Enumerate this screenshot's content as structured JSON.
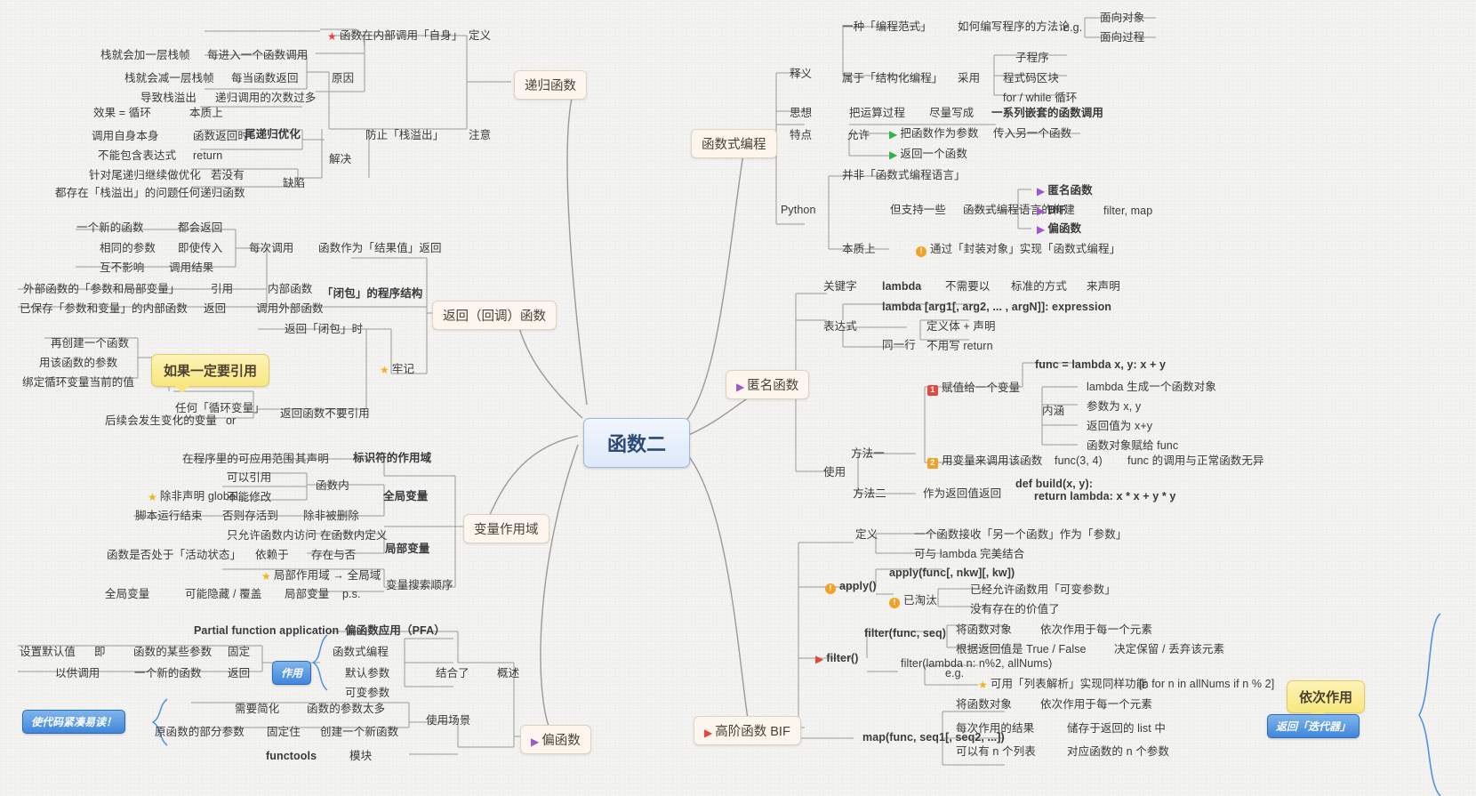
{
  "title": "函数二",
  "colors": {
    "background": "#f3f2f0",
    "center_fill": "#dde9fa",
    "center_border": "#9cb8da",
    "topic_fill": "#fdf6ee",
    "bubble_fill": "#f8e77e",
    "pill_fill": "#3f86dc",
    "star_red": "#e8453c",
    "star_yellow": "#f2b41c",
    "flag_green": "#33b24b",
    "flag_purple": "#9b59d0",
    "flag_red": "#e8453c",
    "warn_orange": "#f0a126"
  },
  "topics": {
    "recursive": "递归函数",
    "functional": "函数式编程",
    "callback": "返回（回调）函数",
    "anonymous": "匿名函数",
    "scope": "变量作用域",
    "hof": "高阶函数 BIF",
    "partial": "偏函数"
  },
  "recursive": {
    "definition_label": "定义",
    "definition_text": "函数在内部调用「自身」",
    "reason_label": "原因",
    "reason_items": [
      {
        "left": "栈就会加一层栈帧",
        "right": "每进入一个函数调用"
      },
      {
        "left": "栈就会减一层栈帧",
        "right": "每当函数返回"
      },
      {
        "left": "导致栈溢出",
        "right": "递归调用的次数过多"
      }
    ],
    "note_label": "注意",
    "note_text": "防止「栈溢出」",
    "solve_label": "解决",
    "tail_title": "尾递归优化",
    "tail_items": [
      {
        "left": "效果 = 循环",
        "right": "本质上"
      },
      {
        "left": "调用自身本身",
        "right": "函数返回时"
      },
      {
        "left": "不能包含表达式",
        "right": "return"
      }
    ],
    "flaw_label": "缺陷",
    "flaw_items": [
      {
        "left": "针对尾递归继续做优化",
        "right": "若没有"
      },
      {
        "left": "都存在「栈溢出」的问题",
        "right": "任何递归函数"
      }
    ]
  },
  "functional": {
    "explain_label": "释义",
    "explain_a_left": "一种「编程范式」",
    "explain_a_mid": "如何编写程序的方法论",
    "explain_a_eg": "e.g.",
    "explain_a_items": [
      "面向对象",
      "面向过程"
    ],
    "explain_b_left": "属于「结构化编程」",
    "explain_b_mid": "采用",
    "explain_b_items": [
      "子程序",
      "程式码区块",
      "for / while 循环"
    ],
    "idea_label": "思想",
    "idea_a": "把运算过程",
    "idea_b": "尽量写成",
    "idea_c": "一系列嵌套的函数调用",
    "feature_label": "特点",
    "feature_allow": "允许",
    "feature_items": [
      {
        "text": "把函数作为参数",
        "tail": "传入另一个函数"
      },
      {
        "text": "返回一个函数",
        "tail": ""
      }
    ],
    "python_label": "Python",
    "python_not": "并非「函数式编程语言」",
    "python_but": "但支持一些",
    "python_but_tail": "函数式编程语言的构建",
    "python_constructs": [
      {
        "text": "匿名函数",
        "tail": ""
      },
      {
        "text": "BIF",
        "tail": "filter, map"
      },
      {
        "text": "偏函数",
        "tail": ""
      }
    ],
    "essence_label": "本质上",
    "essence_text": "通过「封装对象」实现「函数式编程」"
  },
  "callback": {
    "each_call": "每次调用",
    "result_return": "函数作为「结果值」返回",
    "items": [
      {
        "left": "一个新的函数",
        "right": "都会返回"
      },
      {
        "left": "相同的参数",
        "right": "即使传入"
      },
      {
        "left": "互不影响",
        "right": "调用结果"
      }
    ],
    "closure_title": "「闭包」的程序结构",
    "closure_items": [
      {
        "left": "外部函数的「参数和局部变量」",
        "mid": "引用",
        "right": "内部函数"
      },
      {
        "left": "已保存「参数和变量」的内部函数",
        "mid": "返回",
        "right": "调用外部函数"
      }
    ],
    "remember_label": "牢记",
    "when_return_closure": "返回「闭包」时",
    "bubble": "如果一定要引用",
    "bubble_items": [
      "再创建一个函数",
      "用该函数的参数",
      "绑定循环变量当前的值"
    ],
    "loop_var": "任何「循环变量」",
    "later_change": "后续会发生变化的变量",
    "or": "or",
    "dont_reference": "返回函数不要引用"
  },
  "anonymous": {
    "keyword_label": "关键字",
    "keyword": "lambda",
    "keyword_tail_a": "不需要以",
    "keyword_tail_b": "标准的方式",
    "keyword_tail_c": "来声明",
    "expr_label": "表达式",
    "expr_syntax": "lambda [arg1[, arg2, ... , argN]]: expression",
    "expr_sameline": "同一行",
    "expr_items": [
      "定义体 + 声明",
      "不用写 return"
    ],
    "use_label": "使用",
    "method1_label": "方法一",
    "method1_code": "func = lambda x, y: x + y",
    "method1_step1": "赋值给一个变量",
    "inner_label": "内涵",
    "inner_items": [
      "lambda 生成一个函数对象",
      "参数为 x, y",
      "返回值为 x+y",
      "函数对象赋给 func"
    ],
    "method1_step2": "用变量来调用该函数",
    "method1_step2_call": "func(3, 4)",
    "method1_step2_note": "func 的调用与正常函数无异",
    "method2_label": "方法二",
    "method2_text": "作为返回值返回",
    "method2_code_line1": "def build(x, y):",
    "method2_code_line2": "return lambda: x * x + y * y"
  },
  "scope": {
    "ident_scope": "标识符的作用域",
    "ident_scope_a": "在程序里的可应用范围",
    "ident_scope_b": "其声明",
    "global_label": "全局变量",
    "global_in_func": "函数内",
    "global_items": [
      "可以引用",
      "不能修改"
    ],
    "global_unless": "除非声明 global",
    "global_alive_a": "脚本运行结束",
    "global_alive_b": "否则存活到",
    "global_alive_c": "除非被删除",
    "local_label": "局部变量",
    "local_a": "只允许函数内访问",
    "local_b": "在函数内定义",
    "local_c": "函数是否处于「活动状态」",
    "local_d": "依赖于",
    "local_e": "存在与否",
    "search_order": "变量搜索顺序",
    "search_star": "局部作用域 → 全局域",
    "search_a": "全局变量",
    "search_b": "可能隐藏 / 覆盖",
    "search_c": "局部变量",
    "search_ps": "p.s."
  },
  "hof": {
    "define_label": "定义",
    "define_a": "一个函数接收「另一个函数」作为「参数」",
    "define_b": "可与 lambda 完美结合",
    "apply_label": "apply()",
    "apply_sig": "apply(func[, nkw][, kw])",
    "apply_obsolete": "已淘汰",
    "apply_reason_a": "已经允许函数用「可变参数」",
    "apply_reason_b": "没有存在的价值了",
    "filter_label": "filter()",
    "filter_sig": "filter(func, seq)",
    "filter_a_left": "将函数对象",
    "filter_a_right": "依次作用于每一个元素",
    "filter_b_left": "根据返回值是 True / False",
    "filter_b_right": "决定保留 / 丢弃该元素",
    "filter_eg_label": "e.g.",
    "filter_eg_code": "filter(lambda n: n%2, allNums)",
    "filter_eg_star": "可用「列表解析」实现同样功能",
    "filter_eg_star_tail": "[n for n in allNums if n % 2]",
    "map_sig": "map(func, seq1[, seq2, ...])",
    "map_a_left": "将函数对象",
    "map_a_right": "依次作用于每一个元素",
    "map_b_left": "每次作用的结果",
    "map_b_right": "储存于返回的 list 中",
    "map_c_left": "可以有 n 个列表",
    "map_c_right": "对应函数的 n 个参数",
    "bubble": "依次作用",
    "pill": "返回「迭代器」"
  },
  "partial": {
    "title_en": "Partial function application",
    "title_cn": "偏函数应用（PFA）",
    "overview_label": "概述",
    "usage_label": "使用场景",
    "effect_pill": "作用",
    "effect_items": [
      "函数式编程",
      "默认参数",
      "可变参数"
    ],
    "effect_join": "结合了",
    "def_a_left": "设置默认值",
    "def_a_mid": "即",
    "def_a_right": "函数的某些参数",
    "def_a_tail": "固定",
    "def_b_left": "以供调用",
    "def_b_mid": "一个新的函数",
    "def_b_tail": "返回",
    "use_a_left": "需要简化",
    "use_a_right": "函数的参数太多",
    "use_b_left": "原函数的部分参数",
    "use_b_mid": "固定住",
    "use_b_right": "创建一个新函数",
    "code_pill": "使代码紧凑易读！",
    "functools": "functools",
    "functools_label": "模块"
  }
}
